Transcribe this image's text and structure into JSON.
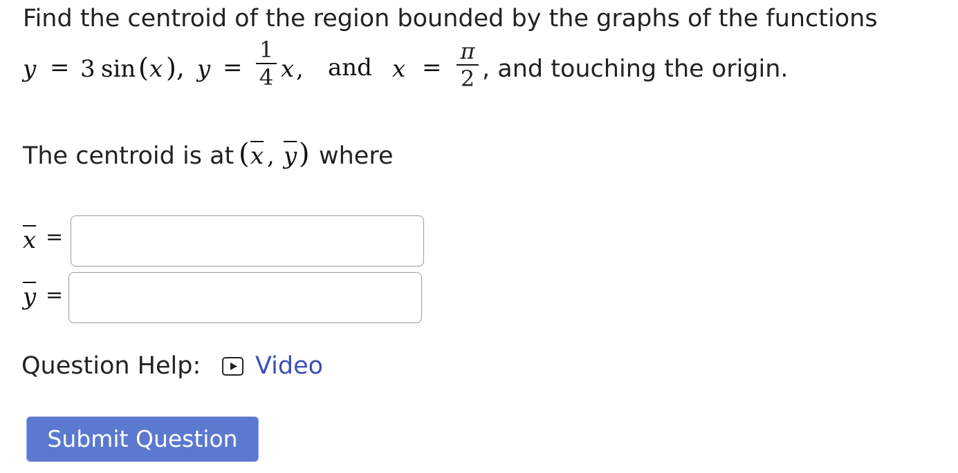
{
  "question": {
    "intro": "Find the centroid of the region bounded by the graphs of the functions",
    "eq_y": "y",
    "eq_equals": "=",
    "eq_sin_coef": "3",
    "eq_sin": "sin",
    "eq_x_in_sin": "x",
    "frac1_num": "1",
    "frac1_den": "4",
    "eq_x": "x",
    "and_text": "and",
    "frac2_num": "π",
    "frac2_den": "2",
    "tail": ", and touching the origin."
  },
  "centroid_prompt": {
    "prefix": "The centroid is at",
    "suffix": "where",
    "xbar_symbol": "x",
    "ybar_symbol": "y"
  },
  "answers": {
    "xbar_label": "x",
    "ybar_label": "y",
    "equals": "=",
    "xbar_value": "",
    "ybar_value": ""
  },
  "help": {
    "label": "Question Help:",
    "video_label": "Video",
    "icon": "play-icon"
  },
  "submit": {
    "label": "Submit Question",
    "color": "#5b79cf"
  }
}
